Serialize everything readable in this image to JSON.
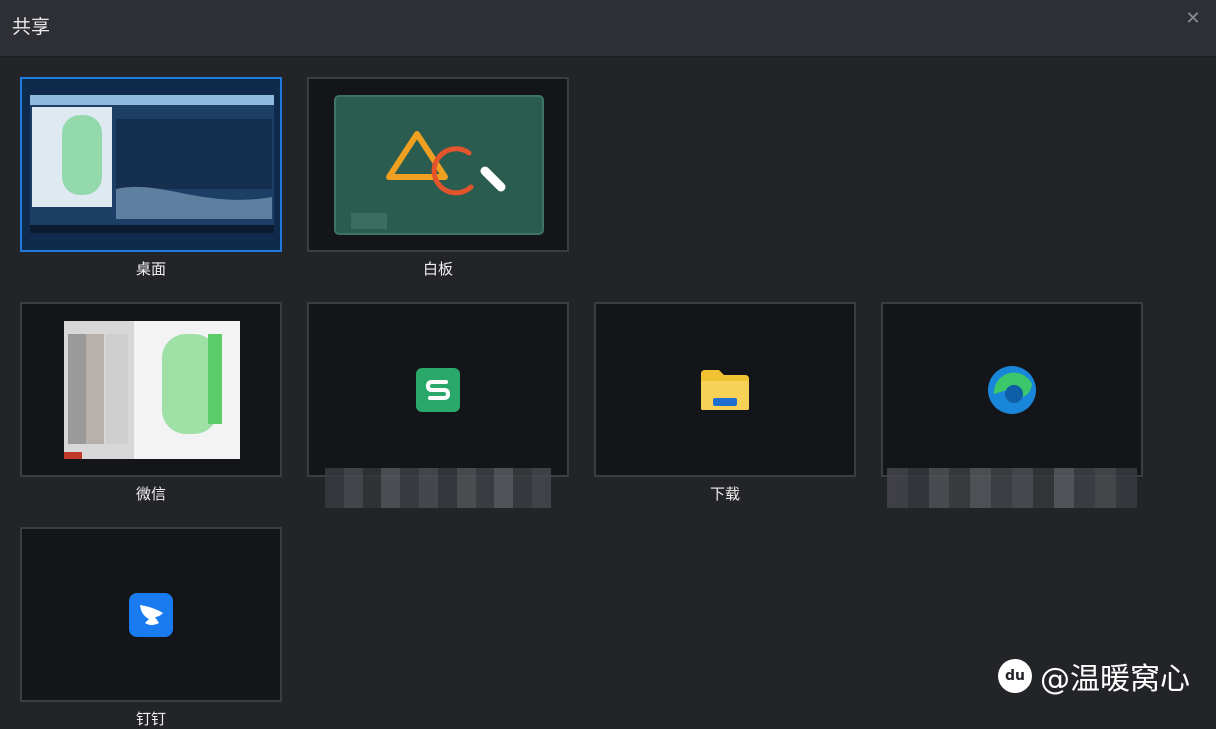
{
  "window": {
    "title": "共享",
    "close_icon": "✕"
  },
  "sources": [
    {
      "label": "桌面",
      "icon": "desktop-preview",
      "selected": true
    },
    {
      "label": "白板",
      "icon": "whiteboard-icon",
      "selected": false
    },
    {
      "label": "微信",
      "icon": "wechat-window-preview",
      "selected": false
    },
    {
      "label": "",
      "icon": "wps-icon",
      "selected": false
    },
    {
      "label": "下载",
      "icon": "folder-icon",
      "selected": false
    },
    {
      "label": "",
      "icon": "edge-icon",
      "selected": false
    },
    {
      "label": "钉钉",
      "icon": "dingtalk-icon",
      "selected": false
    }
  ],
  "watermark": {
    "text": "@温暖窝心",
    "logo": "du"
  },
  "colors": {
    "selected_border": "#1f7ae0",
    "background": "#232428",
    "titlebar": "#2e2f35"
  }
}
